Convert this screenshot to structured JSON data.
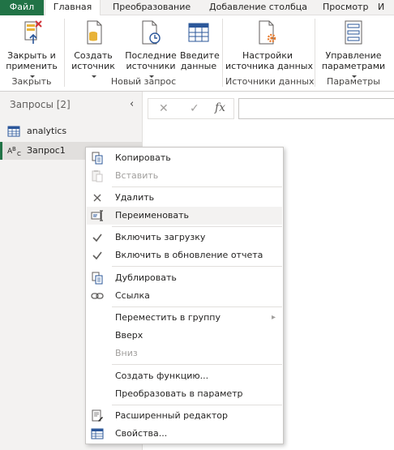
{
  "tabs": [
    {
      "label": "Файл",
      "active": false
    },
    {
      "label": "Главная",
      "active": true
    },
    {
      "label": "Преобразование",
      "active": false
    },
    {
      "label": "Добавление столбца",
      "active": false
    },
    {
      "label": "Просмотр",
      "active": false
    },
    {
      "label": "И",
      "active": false
    }
  ],
  "ribbon": {
    "close_apply": {
      "line1": "Закрыть и",
      "line2": "применить"
    },
    "new_source": {
      "line1": "Создать",
      "line2": "источник"
    },
    "recent_sources": {
      "line1": "Последние",
      "line2": "источники"
    },
    "enter_data": {
      "line1": "Введите",
      "line2": "данные"
    },
    "source_settings": {
      "line1": "Настройки",
      "line2": "источника данных"
    },
    "manage_params": {
      "line1": "Управление",
      "line2": "параметрами"
    },
    "groups": {
      "close": "Закрыть",
      "new_query": "Новый запрос",
      "data_sources": "Источники данных",
      "parameters": "Параметры"
    }
  },
  "queries": {
    "title": "Запросы [2]",
    "items": [
      {
        "name": "analytics",
        "icon": "table-icon",
        "selected": false
      },
      {
        "name": "Запрос1",
        "icon": "abc-text-icon",
        "selected": true
      }
    ]
  },
  "formula_bar": {
    "cancel_icon": "✕",
    "confirm_icon": "✓",
    "fx_label": "fx",
    "value": ""
  },
  "context_menu": {
    "items": [
      {
        "key": "copy",
        "label": "Копировать",
        "icon": "copy-icon",
        "enabled": true
      },
      {
        "key": "paste",
        "label": "Вставить",
        "icon": "paste-icon",
        "enabled": false
      },
      {
        "key": "delete",
        "label": "Удалить",
        "icon": "delete-icon",
        "enabled": true
      },
      {
        "key": "rename",
        "label": "Переименовать",
        "icon": "rename-icon",
        "enabled": true,
        "hover": true
      },
      {
        "key": "enable_load",
        "label": "Включить загрузку",
        "icon": "check-icon",
        "enabled": true,
        "checked": true
      },
      {
        "key": "enable_refresh",
        "label": "Включить в обновление отчета",
        "icon": "check-icon",
        "enabled": true,
        "checked": true
      },
      {
        "key": "duplicate",
        "label": "Дублировать",
        "icon": "duplicate-icon",
        "enabled": true
      },
      {
        "key": "reference",
        "label": "Ссылка",
        "icon": "link-icon",
        "enabled": true
      },
      {
        "key": "move_to_group",
        "label": "Переместить в группу",
        "enabled": true,
        "submenu": true
      },
      {
        "key": "move_up",
        "label": "Вверх",
        "enabled": true
      },
      {
        "key": "move_down",
        "label": "Вниз",
        "enabled": false
      },
      {
        "key": "create_function",
        "label": "Создать функцию...",
        "enabled": true
      },
      {
        "key": "convert_param",
        "label": "Преобразовать в параметр",
        "enabled": true
      },
      {
        "key": "advanced_editor",
        "label": "Расширенный редактор",
        "icon": "advanced-editor-icon",
        "enabled": true
      },
      {
        "key": "properties",
        "label": "Свойства...",
        "icon": "properties-icon",
        "enabled": true
      }
    ]
  },
  "colors": {
    "accent": "#217346",
    "menu_border": "#c8c6c4",
    "pane_bg": "#f3f2f1",
    "icon_blue": "#2b579a",
    "icon_yellow": "#e8b339",
    "icon_red": "#d13438"
  }
}
